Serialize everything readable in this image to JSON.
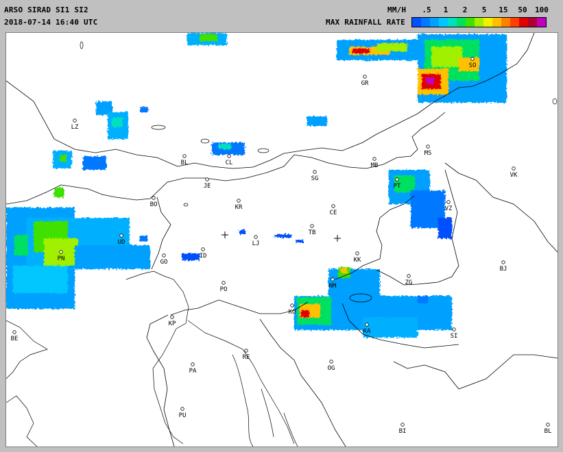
{
  "header": {
    "title": "ARSO SIRAD SI1 SI2",
    "timestamp": "2018-07-14 16:40 UTC",
    "unit": "MM/H",
    "scale_label": "MAX RAINFALL RATE"
  },
  "legend": {
    "ticks": [
      ".5",
      "1",
      "2",
      "5",
      "15",
      "50",
      "100"
    ],
    "colors": [
      "#0050ff",
      "#0078ff",
      "#00a0ff",
      "#00c8ff",
      "#00e0c0",
      "#00e060",
      "#40e000",
      "#a0f000",
      "#f0f000",
      "#ffc000",
      "#ff8000",
      "#ff4000",
      "#e00000",
      "#b00030",
      "#c000c0"
    ]
  },
  "cities": [
    {
      "code": "LZ"
    },
    {
      "code": "BL"
    },
    {
      "code": "CL"
    },
    {
      "code": "GR"
    },
    {
      "code": "SO"
    },
    {
      "code": "MS"
    },
    {
      "code": "MB"
    },
    {
      "code": "VK"
    },
    {
      "code": "SG"
    },
    {
      "code": "JE"
    },
    {
      "code": "BO"
    },
    {
      "code": "KR"
    },
    {
      "code": "CE"
    },
    {
      "code": "PT"
    },
    {
      "code": "VZ"
    },
    {
      "code": "TB"
    },
    {
      "code": "LJ"
    },
    {
      "code": "UD"
    },
    {
      "code": "PN"
    },
    {
      "code": "GO"
    },
    {
      "code": "ID"
    },
    {
      "code": "KK"
    },
    {
      "code": "BJ"
    },
    {
      "code": "NM"
    },
    {
      "code": "ZG"
    },
    {
      "code": "PO"
    },
    {
      "code": "KO"
    },
    {
      "code": "KA"
    },
    {
      "code": "SI"
    },
    {
      "code": "KP"
    },
    {
      "code": "BE"
    },
    {
      "code": "RE"
    },
    {
      "code": "PA"
    },
    {
      "code": "OG"
    },
    {
      "code": "PU"
    },
    {
      "code": "BI"
    },
    {
      "code": "BL"
    }
  ],
  "radars": [
    {
      "name": "SI1"
    },
    {
      "name": "SI2"
    }
  ]
}
